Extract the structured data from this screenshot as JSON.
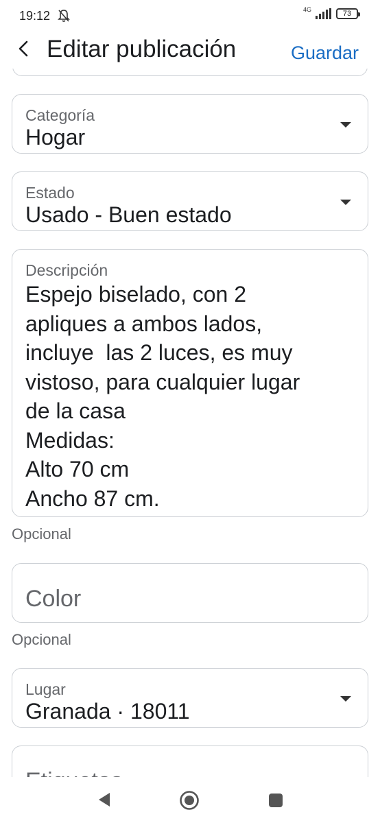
{
  "status_bar": {
    "time": "19:12",
    "network": "4G",
    "battery": "73",
    "icons": [
      "mute-icon",
      "signal-icon",
      "battery-icon"
    ]
  },
  "header": {
    "title": "Editar publicación",
    "save_label": "Guardar",
    "back_icon": "back-arrow-icon",
    "accent_color": "#1a6dc4"
  },
  "form": {
    "category": {
      "label": "Categoría",
      "value": "Hogar"
    },
    "condition": {
      "label": "Estado",
      "value": "Usado - Buen estado"
    },
    "description": {
      "label": "Descripción",
      "value": "Espejo biselado, con 2\napliques a ambos lados,\nincluye  las 2 luces, es muy\nvistoso, para cualquier lugar\nde la casa\nMedidas:\nAlto 70 cm\nAncho 87 cm.",
      "helper": "Opcional"
    },
    "color": {
      "placeholder": "Color",
      "helper": "Opcional"
    },
    "location": {
      "label": "Lugar",
      "value": "Granada · 18011"
    },
    "tags": {
      "placeholder": "Etiquetas"
    }
  },
  "nav_bar": {
    "icons": [
      "nav-back-icon",
      "nav-home-icon",
      "nav-recents-icon"
    ]
  }
}
